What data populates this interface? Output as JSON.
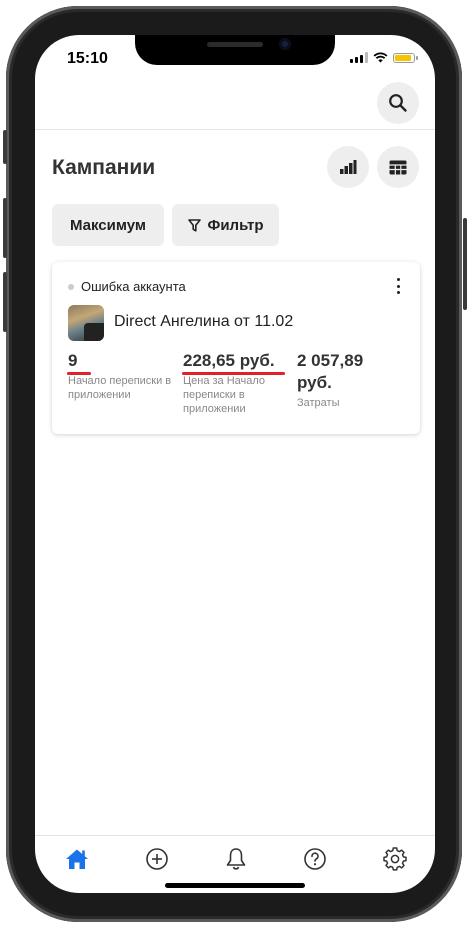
{
  "status_bar": {
    "time": "15:10"
  },
  "header": {
    "search_icon": "search-icon"
  },
  "page": {
    "title": "Кампании"
  },
  "toolbar": {
    "stats_icon": "bar-chart-icon",
    "table_icon": "table-icon",
    "sort_label": "Максимум",
    "filter_label": "Фильтр",
    "filter_icon": "funnel-icon"
  },
  "campaign": {
    "status": "Ошибка аккаунта",
    "name": "Direct Ангелина от 11.02",
    "metrics": [
      {
        "value": "9",
        "label": "Начало переписки в приложении",
        "underlined": true
      },
      {
        "value": "228,65 руб.",
        "label": "Цена за Начало переписки в приложении",
        "underlined": true
      },
      {
        "value": "2 057,89 руб.",
        "label": "Затраты",
        "underlined": false
      }
    ]
  },
  "tab_bar": {
    "items": [
      "home-icon",
      "add-circle-icon",
      "bell-icon",
      "help-icon",
      "gear-icon"
    ],
    "active": "home-icon"
  },
  "colors": {
    "accent": "#1a73e8",
    "underline": "#e0202a",
    "button_bg": "#eeeeee"
  }
}
